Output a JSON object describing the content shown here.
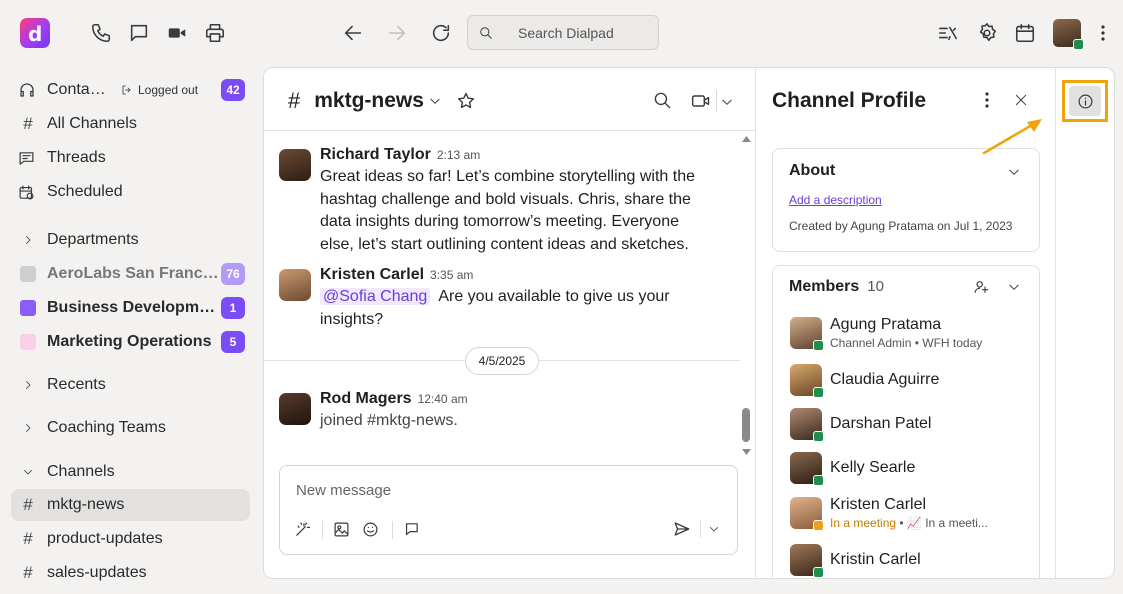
{
  "topbar": {
    "logo_letter": "d",
    "search_placeholder": "Search Dialpad"
  },
  "sidebar": {
    "contacts": {
      "label": "Contac...",
      "status": "Logged out",
      "count": "42"
    },
    "all_channels": "All Channels",
    "threads": "Threads",
    "scheduled": "Scheduled",
    "departments": "Departments",
    "groups": [
      {
        "label": "AeroLabs San Francisc...",
        "count": "76",
        "color": "#cfcfcf"
      },
      {
        "label": "Business Development",
        "count": "1",
        "color": "#8b5cf6"
      },
      {
        "label": "Marketing Operations",
        "count": "5",
        "color": "#fbcfe8"
      }
    ],
    "recents": "Recents",
    "coaching_teams": "Coaching Teams",
    "channels_header": "Channels",
    "channels": [
      "mktg-news",
      "product-updates",
      "sales-updates"
    ]
  },
  "chat": {
    "channel_name": "mktg-news",
    "messages": [
      {
        "author": "Richard Taylor",
        "time": "2:13 am",
        "text": "Great ideas so far! Let’s combine storytelling with the hashtag challenge and bold visuals. Chris, share the data insights during tomorrow’s meeting. Everyone else, let’s start outlining content ideas and sketches."
      },
      {
        "author": "Kristen Carlel",
        "time": "3:35 am",
        "mention": "@Sofia Chang",
        "text": "Are you available to give us your insights?"
      },
      {
        "author": "Rod Magers",
        "time": "12:40 am",
        "text": "joined #mktg-news."
      }
    ],
    "date_divider": "4/5/2025",
    "composer_placeholder": "New message"
  },
  "profile": {
    "title": "Channel Profile",
    "about": {
      "heading": "About",
      "add_description": "Add a description",
      "created_by": "Created by Agung Pratama on Jul 1, 2023"
    },
    "members": {
      "heading": "Members",
      "count": "10",
      "list": [
        {
          "name": "Agung Pratama",
          "role": "Channel Admin",
          "status": "WFH today"
        },
        {
          "name": "Claudia Aguirre"
        },
        {
          "name": "Darshan Patel"
        },
        {
          "name": "Kelly Searle"
        },
        {
          "name": "Kristen Carlel",
          "presence": "In a meeting",
          "status": "In a meeti..."
        },
        {
          "name": "Kristin Carlel"
        }
      ]
    }
  },
  "colors": {
    "accent": "#7a4df4",
    "highlight_box": "#f0a30a",
    "link": "#6a3fd6",
    "presence_green": "#1e8e4a",
    "presence_orange": "#e8a21c"
  }
}
